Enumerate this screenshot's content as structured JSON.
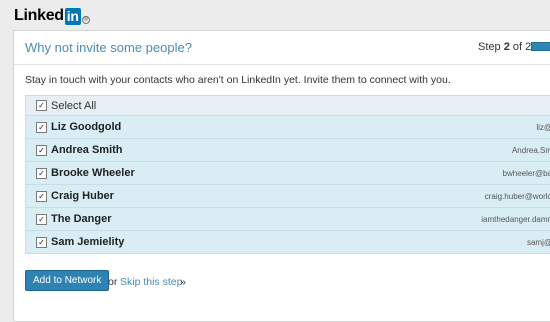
{
  "brand": {
    "logo_text": "Linked",
    "logo_badge": "in",
    "logo_mark": "®"
  },
  "header": {
    "title": "Why not invite some people?",
    "step_label": "Step",
    "step_current": "2",
    "step_of": "of 2",
    "progress": 1.0
  },
  "intro": "Stay in touch with your contacts who aren't on LinkedIn yet. Invite them to connect with you.",
  "select_all": {
    "label": "Select All",
    "checked": true
  },
  "contacts": [
    {
      "name": "Liz Goodgold",
      "email": "liz@",
      "checked": true
    },
    {
      "name": "Andrea Smith",
      "email": "Andrea.Sm",
      "checked": true
    },
    {
      "name": "Brooke Wheeler",
      "email": "bwheeler@ba",
      "checked": true
    },
    {
      "name": "Craig Huber",
      "email": "craig.huber@world",
      "checked": true
    },
    {
      "name": "The Danger",
      "email": "iamthedanger.damn",
      "checked": true
    },
    {
      "name": "Sam Jemielity",
      "email": "samj@",
      "checked": true
    }
  ],
  "actions": {
    "add_label": "Add to Network",
    "or_label": "or",
    "skip_label": "Skip this step",
    "skip_suffix": "»"
  },
  "colors": {
    "accent": "#2e83b3",
    "link": "#4a8cb4",
    "row_bg": "#d9edf5"
  }
}
